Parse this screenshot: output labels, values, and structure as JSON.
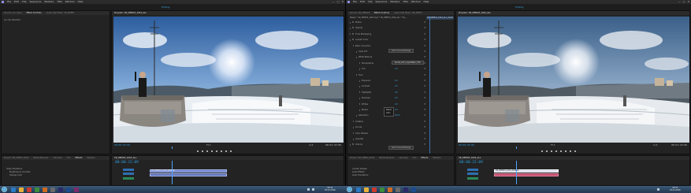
{
  "menu": [
    "File",
    "Edit",
    "Clip",
    "Sequence",
    "Markers",
    "Title",
    "Window",
    "Help"
  ],
  "workspace": "Editing",
  "window_controls": [
    "—",
    "□",
    "✕"
  ],
  "left": {
    "source_panel": {
      "tabs": [
        "Source: (no clips)",
        "Effect Controls",
        "Audio Clip Mixer: VR_DEMO",
        "Metadata"
      ],
      "content": "(no clip selected)"
    },
    "program_panel": {
      "tabs": [
        "Program: VR_DEMO3_1024_ALL"
      ],
      "timecode_left": "00:00:22:09",
      "timecode_right": "00:01:22:06",
      "fit_label": "Fit",
      "quality_label": "1/2"
    },
    "project_panel": {
      "tabs": [
        "Project: VR_DEMO_1024",
        "Media Browser",
        "Libraries",
        "Info",
        "Effects",
        "Markers",
        "History"
      ],
      "items": [
        "Video Transitions",
        "Brightness & Contrast",
        "Change Color"
      ]
    },
    "timeline": {
      "tabs": [
        "VR_DEMO3_1024_ALL"
      ],
      "timecode": "00:00:22:09",
      "clip_label": "VR_DEMO3_1024_MOBAR"
    }
  },
  "right": {
    "effect_controls": {
      "tabs": [
        "Source: VR_DEMO3",
        "Effect Controls",
        "Audio Clip Mixer: VR_DEMO",
        "Metadata"
      ],
      "header": "Master * VR_DEMO3_1024.mp4 * VR_DEMO3_1024_ALL * VR_...",
      "rows": [
        {
          "label": "Motion",
          "value": "",
          "depth": 0
        },
        {
          "label": "Opacity",
          "value": "",
          "depth": 0
        },
        {
          "label": "Time Remapping",
          "value": "",
          "depth": 0
        },
        {
          "label": "Lumetri Color",
          "value": "",
          "depth": 0
        },
        {
          "label": "Basic Correction",
          "value": "",
          "depth": 1
        },
        {
          "label": "Input LUT",
          "value": "",
          "depth": 2
        },
        {
          "label": "White Balance",
          "value": "",
          "depth": 2
        },
        {
          "label": "Temperature",
          "value": "0.0",
          "depth": 3
        },
        {
          "label": "Tint",
          "value": "0.0",
          "depth": 3
        },
        {
          "label": "Tone",
          "value": "",
          "depth": 2
        },
        {
          "label": "Exposure",
          "value": "0.0",
          "depth": 3
        },
        {
          "label": "Contrast",
          "value": "0.0",
          "depth": 3
        },
        {
          "label": "Highlights",
          "value": "0.0",
          "depth": 3
        },
        {
          "label": "Shadows",
          "value": "0.0",
          "depth": 3
        },
        {
          "label": "Whites",
          "value": "0.0",
          "depth": 3
        },
        {
          "label": "Blacks",
          "value": "0.0",
          "depth": 3
        },
        {
          "label": "Saturation",
          "value": "100.0",
          "depth": 2
        },
        {
          "label": "Creative",
          "value": "",
          "depth": 1
        },
        {
          "label": "Curves",
          "value": "",
          "depth": 1
        },
        {
          "label": "Color Wheels",
          "value": "",
          "depth": 1
        },
        {
          "label": "Vignette",
          "value": "",
          "depth": 1
        },
        {
          "label": "Volume",
          "value": "",
          "depth": 0
        }
      ],
      "reset_button": "Auto Convert Range",
      "lut_select": "Kunst_LUT_LogoC2Rec_709",
      "bottom_button": "Auto Convert Range",
      "dropdown_options": [
        "Reset",
        "Auto"
      ],
      "sequence_label": "VR_DEMO3_1024_ALL_GOLD"
    },
    "program_panel": {
      "tabs": [
        "Program: VR_DEMO3_1024_ALL"
      ],
      "timecode_left": "00:00:22:09",
      "timecode_right": "00:01:22:06",
      "fit_label": "Fit",
      "quality_label": "1/2"
    },
    "project_panel": {
      "tabs": [
        "Project: VR_DEMO_1024",
        "Media Browser",
        "Libraries",
        "Info",
        "Effects",
        "Markers"
      ],
      "items": [
        "Lumetri Presets",
        "Audio Effects",
        "Audio Transitions"
      ]
    },
    "timeline": {
      "tabs": [
        "VR_DEMO3_1024_ALL"
      ],
      "timecode": "00:00:22:09",
      "clip_label": "VR_DEMO3_1024_MOBAR"
    }
  },
  "taskbar": {
    "clock_time": "09:12",
    "clock_date": "25.01.2016"
  }
}
